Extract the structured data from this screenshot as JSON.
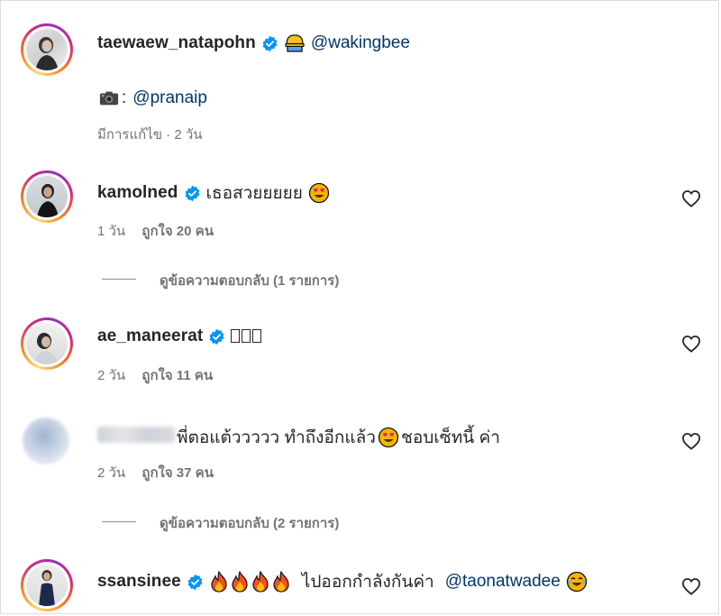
{
  "caption": {
    "username": "taewaew_natapohn",
    "mention_1": "@wakingbee",
    "camera_prefix": ":",
    "mention_2": "@pranaip",
    "meta": "มีการแก้ไข · 2 วัน"
  },
  "comments": [
    {
      "username": "kamolned",
      "text": "เธอสวยยยยย",
      "time": "1 วัน",
      "likes": "ถูกใจ 20 คน",
      "replies": "ดูข้อความตอบกลับ (1 รายการ)"
    },
    {
      "username": "ae_maneerat",
      "text": "",
      "time": "2 วัน",
      "likes": "ถูกใจ 11 คน"
    },
    {
      "username": "",
      "text": "พี่ตอแต้ววววว ทำถึงอีกแล้ว",
      "text_2": "ชอบเซ็ทนี้ ค่า",
      "time": "2 วัน",
      "likes": "ถูกใจ 37 คน",
      "replies": "ดูข้อความตอบกลับ (2 รายการ)"
    },
    {
      "username": "ssansinee",
      "text": "ไปออกกำลังกันค่า",
      "mention": "@taonatwadee"
    }
  ],
  "colors": {
    "text": "#262626",
    "secondary": "#737373",
    "mention": "#00376b",
    "verified": "#0095f6"
  },
  "icons": [
    "verified-badge-icon",
    "heart-icon",
    "camera-icon",
    "fire-emoji",
    "heart-eyes-emoji",
    "tears-of-joy-emoji",
    "construction-worker-emoji"
  ]
}
